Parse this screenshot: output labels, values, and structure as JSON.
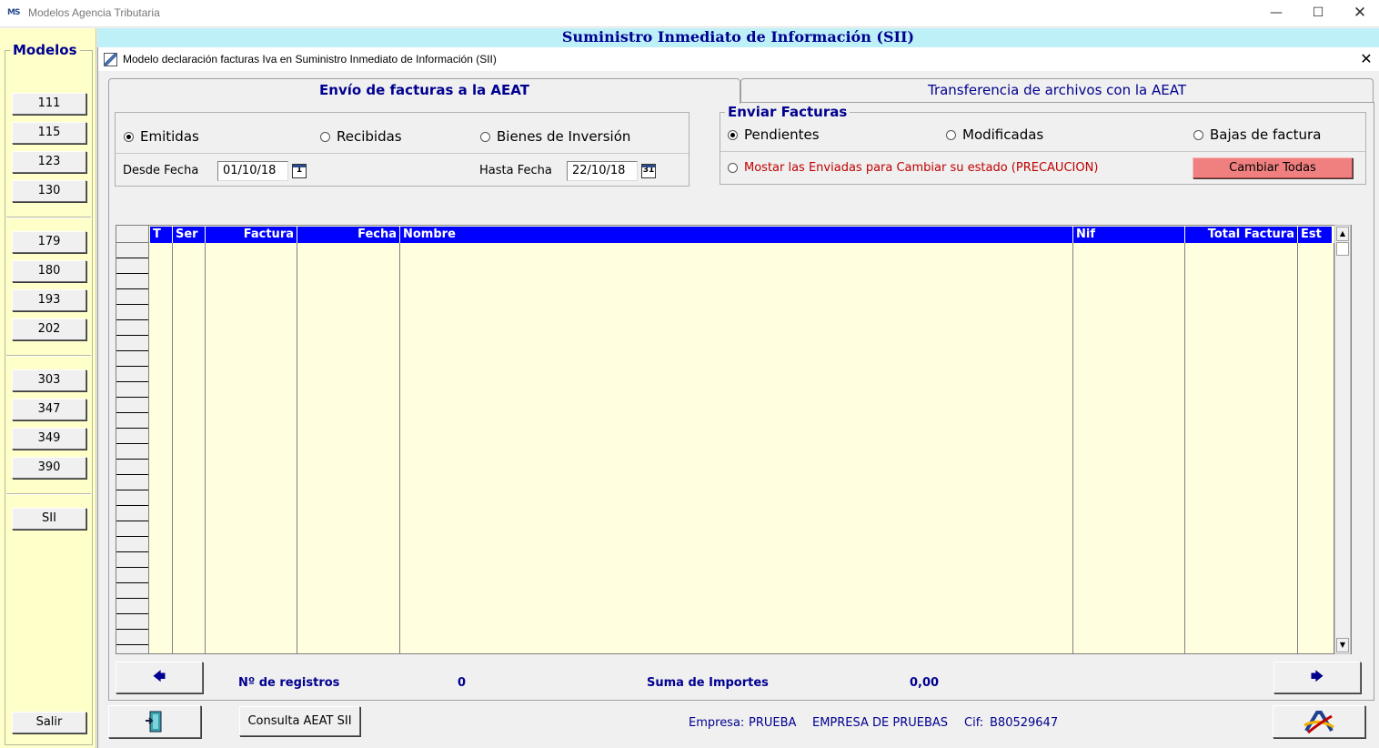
{
  "app": {
    "title": "Modelos Agencia Tributaria",
    "icon_text": "MS",
    "min": "—",
    "max": "☐",
    "close": "✕"
  },
  "sidebar": {
    "title": "Modelos",
    "buttons": [
      "111",
      "115",
      "123",
      "130",
      "179",
      "180",
      "193",
      "202",
      "303",
      "347",
      "349",
      "390",
      "SII"
    ],
    "exit_label": "Salir"
  },
  "header": {
    "title": "Suministro Inmediato de Información (SII)"
  },
  "child": {
    "title": "Modelo declaración facturas Iva en Suministro Inmediato de Información (SII)",
    "close": "✕"
  },
  "tabs": [
    {
      "label": "Envío de facturas a la AEAT",
      "active": true
    },
    {
      "label": "Transferencia de archivos con la AEAT",
      "active": false
    }
  ],
  "filter": {
    "types": [
      {
        "label": "Emitidas",
        "checked": true
      },
      {
        "label": "Recibidas",
        "checked": false
      },
      {
        "label": "Bienes de Inversión",
        "checked": false
      }
    ],
    "desde_label": "Desde Fecha",
    "desde_value": "01/10/18",
    "desde_cal": "1",
    "hasta_label": "Hasta Fecha",
    "hasta_value": "22/10/18",
    "hasta_cal": "31"
  },
  "enviar": {
    "title": "Enviar Facturas",
    "options": [
      {
        "label": "Pendientes",
        "checked": true
      },
      {
        "label": "Modificadas",
        "checked": false
      },
      {
        "label": "Bajas de factura",
        "checked": false
      }
    ],
    "show_sent_label": "Mostar las Enviadas para Cambiar su estado (PRECAUCION)",
    "change_all_label": "Cambiar Todas",
    "warn_color": "#c00000",
    "button_color": "#f08080"
  },
  "grid": {
    "header_color": "#0000ff",
    "background": "#ffffe0",
    "columns": [
      "T",
      "Ser",
      "Factura",
      "Fecha",
      "Nombre",
      "Nif",
      "Total Factura",
      "Est"
    ],
    "rows": []
  },
  "stats": {
    "registros_label": "Nº de registros",
    "registros_value": "0",
    "importes_label": "Suma de Importes",
    "importes_value": "0,00",
    "prev_icon": "🡄",
    "next_icon": "🡆"
  },
  "footer": {
    "consulta_label": "Consulta AEAT SII",
    "empresa_label": "Empresa:",
    "empresa_code": "PRUEBA",
    "empresa_name": "EMPRESA DE PRUEBAS",
    "cif_label": "Cif:",
    "cif_value": "B80529647"
  }
}
